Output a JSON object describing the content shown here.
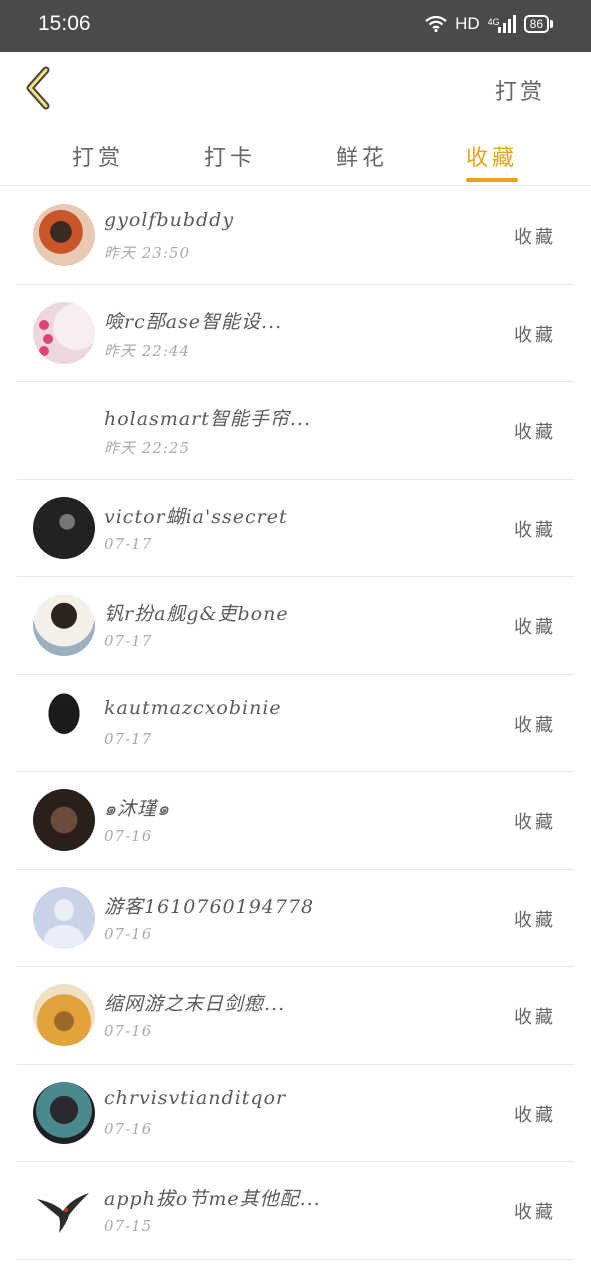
{
  "status_bar": {
    "time": "15:06",
    "network_type": "HD",
    "network_gen": "4G",
    "battery": "86"
  },
  "header": {
    "action_label": "打赏"
  },
  "tabs": [
    {
      "label": "打赏",
      "active": false
    },
    {
      "label": "打卡",
      "active": false
    },
    {
      "label": "鲜花",
      "active": false
    },
    {
      "label": "收藏",
      "active": true
    }
  ],
  "accent_color": "#e9a31b",
  "list": [
    {
      "name": "gyolfbubddy",
      "time": "昨天 23:50",
      "action": "收藏",
      "avatar": "photo-avatar"
    },
    {
      "name": "噞rc郚ase智能设...",
      "time": "昨天 22:44",
      "action": "收藏",
      "avatar": "hearts-avatar"
    },
    {
      "name": "holasmart智能手帘...",
      "time": "昨天 22:25",
      "action": "收藏",
      "avatar": "blank-avatar"
    },
    {
      "name": "victor蝴ia'ssecret",
      "time": "07-17",
      "action": "收藏",
      "avatar": "photo-avatar"
    },
    {
      "name": "钒r扮a舰g&吏bone",
      "time": "07-17",
      "action": "收藏",
      "avatar": "photo-avatar"
    },
    {
      "name": "kautmazcxobinie",
      "time": "07-17",
      "action": "收藏",
      "avatar": "photo-avatar"
    },
    {
      "name": "๑沐瑾๑",
      "time": "07-16",
      "action": "收藏",
      "avatar": "photo-avatar"
    },
    {
      "name": "游客1610760194778",
      "time": "07-16",
      "action": "收藏",
      "avatar": "default-user-avatar"
    },
    {
      "name": "缩网游之末日剑瘛...",
      "time": "07-16",
      "action": "收藏",
      "avatar": "photo-avatar"
    },
    {
      "name": "chrvisvtianditqor",
      "time": "07-16",
      "action": "收藏",
      "avatar": "photo-avatar"
    },
    {
      "name": "apph拔o节me其他配...",
      "time": "07-15",
      "action": "收藏",
      "avatar": "swallow-bird-avatar"
    }
  ]
}
